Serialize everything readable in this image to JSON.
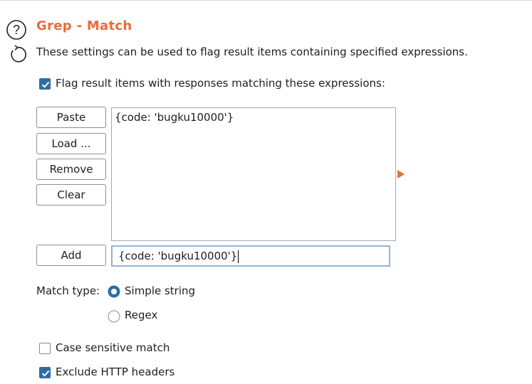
{
  "header": {
    "title": "Grep - Match",
    "description": "These settings can be used to flag result items containing specified expressions.",
    "help_icon": "help-circle-icon",
    "refresh_icon": "refresh-icon"
  },
  "flag_checkbox": {
    "label": "Flag result items with responses matching these expressions:",
    "checked": true
  },
  "buttons": {
    "paste": "Paste",
    "load": "Load ...",
    "remove": "Remove",
    "clear": "Clear",
    "add": "Add"
  },
  "expressions": [
    "{code: 'bugku10000'}"
  ],
  "add_input": {
    "value": "{code: 'bugku10000'}"
  },
  "match_type": {
    "label": "Match type:",
    "options": [
      {
        "label": "Simple string",
        "selected": true
      },
      {
        "label": "Regex",
        "selected": false
      }
    ]
  },
  "options": {
    "case_sensitive": {
      "label": "Case sensitive match",
      "checked": false
    },
    "exclude_headers": {
      "label": "Exclude HTTP headers",
      "checked": true
    }
  },
  "colors": {
    "accent": "#ec6b3a",
    "checkbox": "#2e6da4",
    "radio": "#2e6da4"
  }
}
